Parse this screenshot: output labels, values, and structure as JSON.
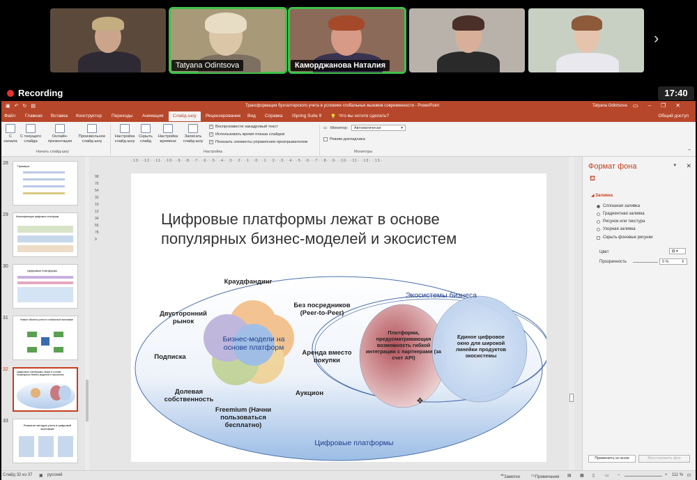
{
  "video": {
    "participants": [
      {
        "name": "",
        "active": false
      },
      {
        "name": "Tatyana Odintsova",
        "active": true
      },
      {
        "name": "Каморджанова Наталия",
        "active": true
      },
      {
        "name": "",
        "active": false
      },
      {
        "name": "",
        "active": false
      }
    ],
    "next_icon": "›",
    "recording_label": "Recording",
    "clock": "17:40"
  },
  "ppt": {
    "doc_title": "Трансформация бухгалтерского учета в условиях глобальных вызовов современности  -  PowerPoint",
    "user": "Tatyana Odintsova",
    "tabs": [
      "Файл",
      "Главная",
      "Вставка",
      "Конструктор",
      "Переходы",
      "Анимация",
      "Слайд-шоу",
      "Рецензирование",
      "Вид",
      "Справка",
      "iSpring Suite 9"
    ],
    "tell_me": "Что вы хотите сделать?",
    "share": "Общий доступ",
    "ribbon": {
      "from_start": "С начала",
      "from_current": "С текущего слайда",
      "online": "Онлайн-презентация",
      "custom": "Произвольное слайд-шоу",
      "group_start": "Начать слайд-шоу",
      "setup": "Настройка слайд-шоу",
      "hide": "Скрыть слайд",
      "rehearse": "Настройка времени",
      "record": "Записать слайд-шоу",
      "chk_narration": "Воспроизвести закадровый текст",
      "chk_timings": "Использовать время показа слайдов",
      "chk_controls": "Показать элементы управления проигрывателем",
      "group_setup": "Настройка",
      "monitor_label": "Монитор:",
      "monitor_value": "Автоматически",
      "presenter": "Режим докладчика",
      "group_monitors": "Мониторы"
    },
    "thumbs": [
      {
        "num": "28",
        "title": "Примеры"
      },
      {
        "num": "29",
        "title": "Классификация цифровых платформ"
      },
      {
        "num": "30",
        "title": "Цифровые платформы"
      },
      {
        "num": "31",
        "title": "Новые объекты учета в глобальной экономике"
      },
      {
        "num": "32",
        "title": "Цифровые платформы лежат в основе популярных бизнес-моделей и экосистем"
      },
      {
        "num": "33",
        "title": "Развитие методов учета в цифровой экономике"
      }
    ],
    "ruler_h": "·13· ·12· ·11· ·10· ·9· ·8· ·7· ·6· ·5· ·4· ·3· ·2· ·1· ·0· ·1· ·2· ·3· ·4· ·5· ·6· ·7· ·8· ·9· ·10· ·11· ·12· ·13·",
    "ruler_v": "9876543210123456789",
    "slide": {
      "title": "Цифровые платформы лежат в основе популярных бизнес-моделей и экосистем",
      "center": "Бизнес-модели на основе платформ",
      "models": {
        "crowdfunding": "Краудфандинг",
        "two_sided": "Двусторонний рынок",
        "p2p": "Без посредников (Peer-to-Peer)",
        "subscription": "Подписка",
        "rent": "Аренда вместо покупки",
        "equity": "Долевая собственность",
        "auction": "Аукцион",
        "freemium": "Freemium (Начни пользоваться бесплатно)"
      },
      "eco_title": "Экосистемы бизнеса",
      "eco_left": "Платформа, предусматривающая возможность гибкой интеграции с партнерами (за счет API)",
      "eco_right": "Единое цифровое окно для широкой линейки продуктов экосистемы",
      "bottom": "Цифровые платформы"
    },
    "pane": {
      "title": "Формат фона",
      "fill_header": "Заливка",
      "options": [
        "Сплошная заливка",
        "Градиентная заливка",
        "Рисунок или текстура",
        "Узорная заливка"
      ],
      "selected_option": 0,
      "hide_bg": "Скрыть фоновые рисунки",
      "color_label": "Цвет",
      "transparency_label": "Прозрачность",
      "transparency_value": "0 %",
      "apply_all": "Применить ко всем",
      "reset": "Восстановить фон"
    },
    "status": {
      "slide_info": "Слайд 32 из 37",
      "language": "русский",
      "notes": "Заметки",
      "comments": "Примечания",
      "zoom": "111 %"
    }
  }
}
